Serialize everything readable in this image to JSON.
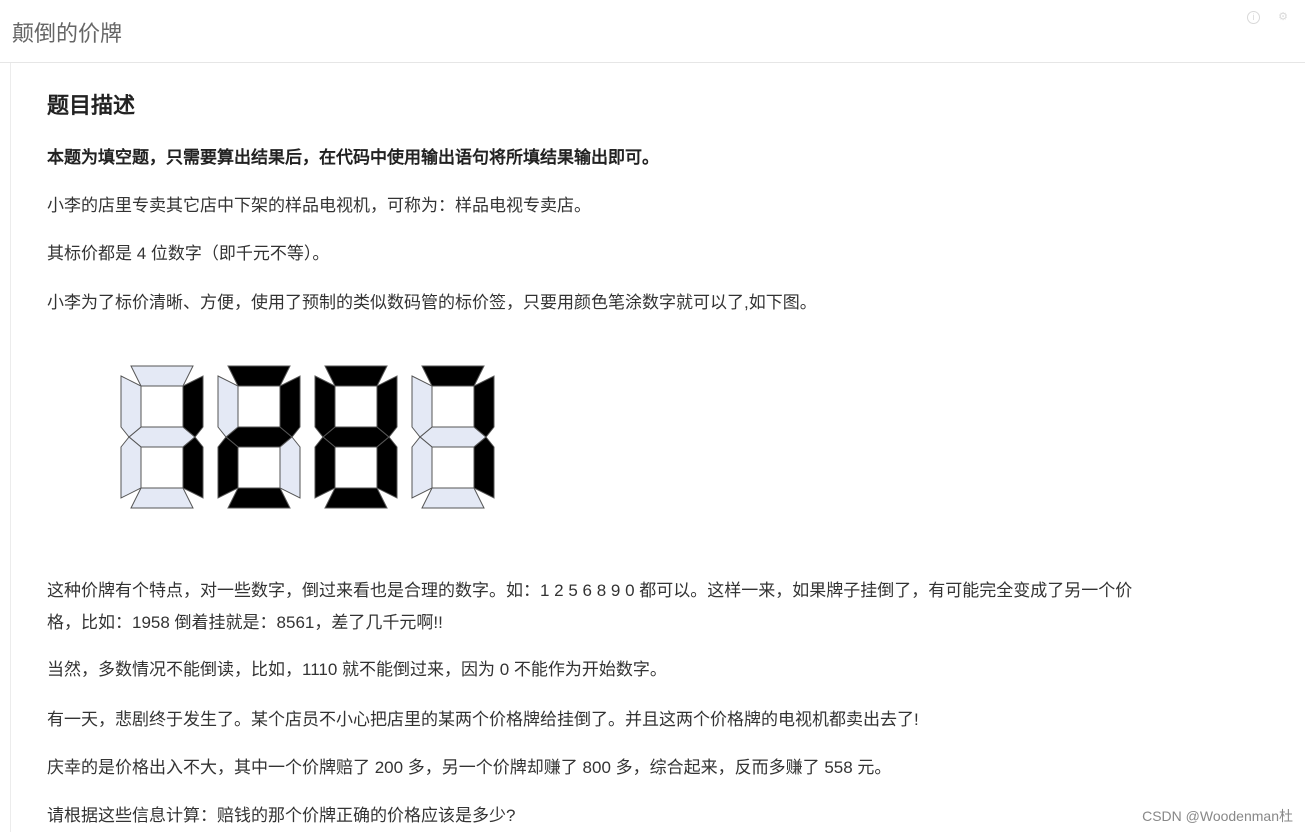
{
  "page": {
    "title": "颠倒的价牌"
  },
  "problem": {
    "heading": "题目描述",
    "instruction": "本题为填空题，只需要算出结果后，在代码中使用输出语句将所填结果输出即可。",
    "p1": "小李的店里专卖其它店中下架的样品电视机，可称为：样品电视专卖店。",
    "p2": "其标价都是 4 位数字（即千元不等）。",
    "p3": "小李为了标价清晰、方便，使用了预制的类似数码管的标价签，只要用颜色笔涂数字就可以了,如下图。",
    "p5": "这种价牌有个特点，对一些数字，倒过来看也是合理的数字。如：1 2 5 6 8 9 0 都可以。这样一来，如果牌子挂倒了，有可能完全变成了另一个价",
    "p5b": "格，比如：1958 倒着挂就是：8561，差了几千元啊!!",
    "p6": "当然，多数情况不能倒读，比如，1110 就不能倒过来，因为 0 不能作为开始数字。",
    "p7": "有一天，悲剧终于发生了。某个店员不小心把店里的某两个价格牌给挂倒了。并且这两个价格牌的电视机都卖出去了!",
    "p8": "庆幸的是价格出入不大，其中一个价牌赔了 200 多，另一个价牌却赚了 800 多，综合起来，反而多赚了 558 元。",
    "p9": "请根据这些信息计算：赔钱的那个价牌正确的价格应该是多少?"
  },
  "figure": {
    "digits": [
      "1",
      "2",
      "8",
      "7"
    ],
    "on_color": "#000000",
    "off_color": "#e4e9f5"
  },
  "watermark": "CSDN @Woodenman杜",
  "icons": {
    "info": "info-icon",
    "gear": "gear-icon"
  }
}
